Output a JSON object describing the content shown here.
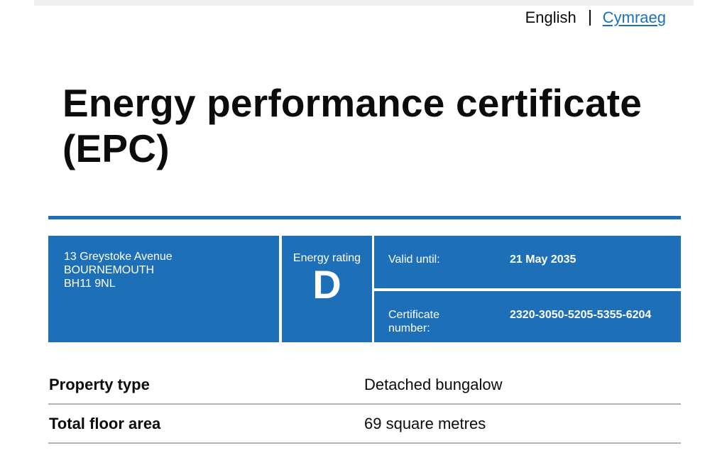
{
  "language": {
    "current": "English",
    "alternate": "Cymraeg"
  },
  "title": "Energy performance certificate (EPC)",
  "certificate": {
    "address": [
      "13 Greystoke Avenue",
      "BOURNEMOUTH",
      "BH11 9NL"
    ],
    "energy_rating_label": "Energy rating",
    "energy_rating": "D",
    "valid_until_label": "Valid until:",
    "valid_until": "21 May 2035",
    "certificate_number_label": "Certificate number:",
    "certificate_number": "2320-3050-5205-5355-6204"
  },
  "summary": [
    {
      "key": "Property type",
      "value": "Detached bungalow"
    },
    {
      "key": "Total floor area",
      "value": "69 square metres"
    }
  ],
  "colors": {
    "brand_blue": "#1d70b8",
    "text": "#0b0c0c",
    "rule_grey": "#b1b4b6"
  }
}
